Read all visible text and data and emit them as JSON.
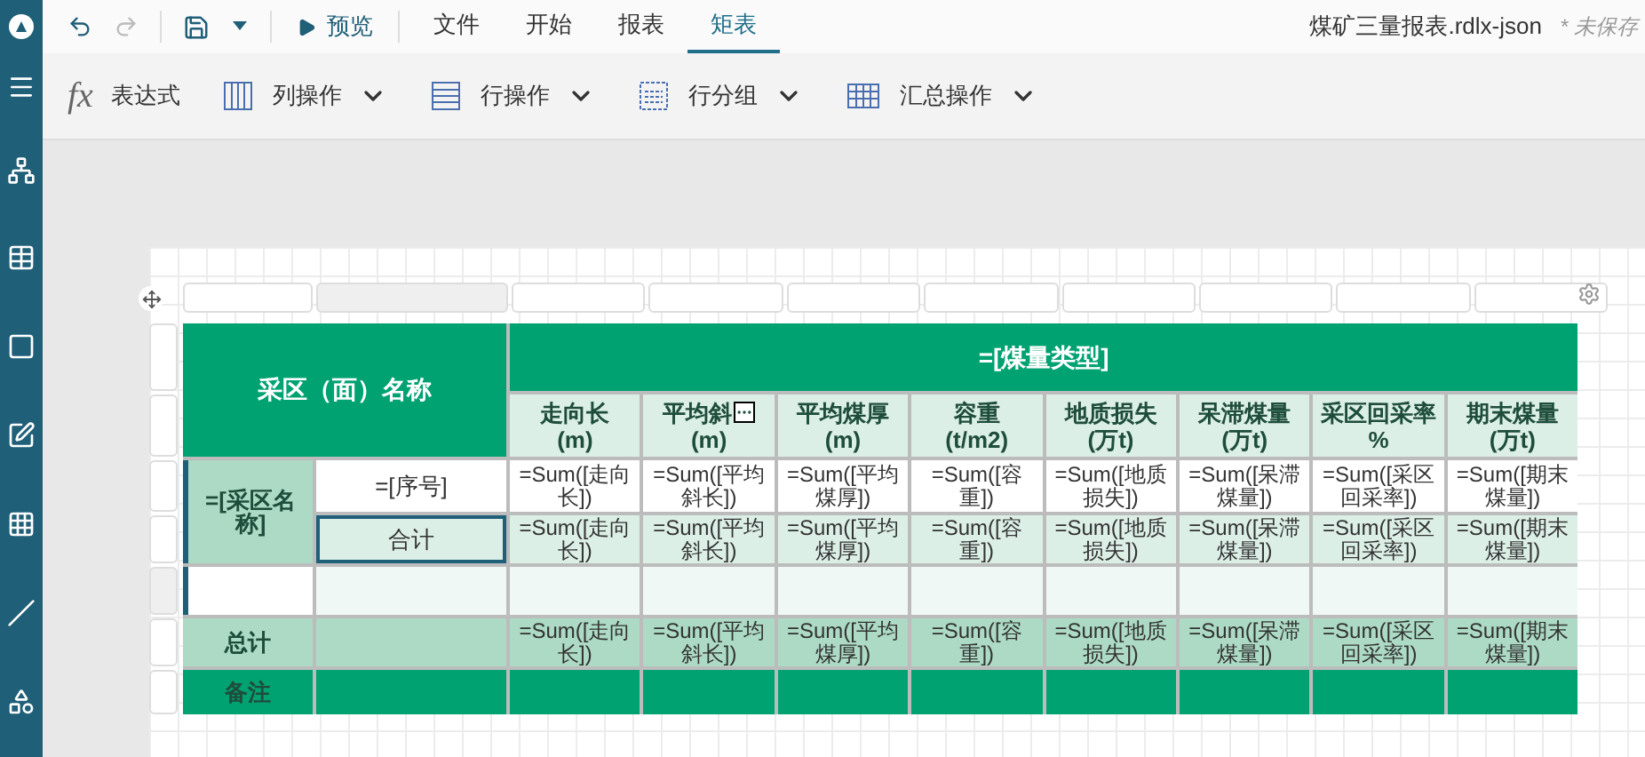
{
  "history": [
    {
      "kind": "undo",
      "disabled": false
    },
    {
      "kind": "redo",
      "disabled": true
    }
  ],
  "preview": {
    "label": "预览"
  },
  "tabs": [
    {
      "label": "文件",
      "selected": false
    },
    {
      "label": "开始",
      "selected": false
    },
    {
      "label": "报表",
      "selected": false
    },
    {
      "label": "矩表",
      "selected": true
    }
  ],
  "file": {
    "name": "煤矿三量报表.rdlx-json",
    "status": "* 未保存"
  },
  "ribbon": [
    {
      "kind": "expression",
      "glyph": "fx",
      "label": "表达式",
      "dropdown": false
    },
    {
      "kind": "columns",
      "label": "列操作",
      "dropdown": true
    },
    {
      "kind": "rows",
      "label": "行操作",
      "dropdown": true
    },
    {
      "kind": "groups",
      "label": "行分组",
      "dropdown": true
    },
    {
      "kind": "totals",
      "label": "汇总操作",
      "dropdown": true
    }
  ],
  "table": {
    "corner": "采区（面）名称",
    "column_group": "=[煤量类型]",
    "columns": [
      {
        "lines": [
          "走向长",
          "(m)"
        ],
        "menu": false
      },
      {
        "lines": [
          "平均斜",
          "(m)"
        ],
        "menu": true
      },
      {
        "lines": [
          "平均煤厚",
          "(m)"
        ],
        "menu": false
      },
      {
        "lines": [
          "容重",
          "(t/m2)"
        ],
        "menu": false
      },
      {
        "lines": [
          "地质损失",
          "(万t)"
        ],
        "menu": false
      },
      {
        "lines": [
          "呆滞煤量",
          "(万t)"
        ],
        "menu": false
      },
      {
        "lines": [
          "采区回采率",
          "%"
        ],
        "menu": false
      },
      {
        "lines": [
          "期末煤量",
          "(万t)"
        ],
        "menu": false
      }
    ],
    "row_group": "=[采区名称]",
    "rows": [
      {
        "kind": "detail",
        "label": "=[序号]",
        "selected": false,
        "cells": [
          "=Sum([走向长])",
          "=Sum([平均斜长])",
          "=Sum([平均煤厚])",
          "=Sum([容重])",
          "=Sum([地质损失])",
          "=Sum([呆滞煤量])",
          "=Sum([采区回采率])",
          "=Sum([期末煤量])"
        ]
      },
      {
        "kind": "subtotal",
        "label": "合计",
        "selected": true,
        "cells": [
          "=Sum([走向长])",
          "=Sum([平均斜长])",
          "=Sum([平均煤厚])",
          "=Sum([容重])",
          "=Sum([地质损失])",
          "=Sum([呆滞煤量])",
          "=Sum([采区回采率])",
          "=Sum([期末煤量])"
        ]
      },
      {
        "kind": "empty",
        "selected": false
      }
    ],
    "total": {
      "label": "总计",
      "cells": [
        "=Sum([走向长])",
        "=Sum([平均斜长])",
        "=Sum([平均煤厚])",
        "=Sum([容重])",
        "=Sum([地质损失])",
        "=Sum([呆滞煤量])",
        "=Sum([采区回采率])",
        "=Sum([期末煤量])"
      ]
    },
    "remark": {
      "label": "备注"
    }
  }
}
